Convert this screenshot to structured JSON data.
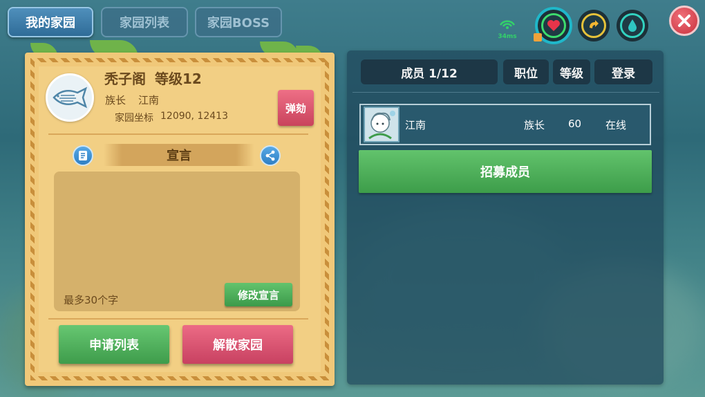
{
  "tabs": [
    {
      "label": "我的家园",
      "active": true
    },
    {
      "label": "家园列表",
      "active": false
    },
    {
      "label": "家园BOSS",
      "active": false
    }
  ],
  "status": {
    "ping": "34ms",
    "icons": [
      "heart-icon",
      "refresh-icon",
      "water-drop-icon"
    ]
  },
  "family": {
    "name": "秃子阁",
    "level_text": "等级12",
    "leader_label": "族长",
    "leader_name": "江南",
    "coord_label": "家园坐标",
    "coords": "12090, 12413",
    "impeach_label": "弹劾"
  },
  "declaration": {
    "title": "宣言",
    "char_limit": "最多30个字",
    "edit_label": "修改宣言"
  },
  "actions": {
    "apply_list": "申请列表",
    "disband": "解散家园"
  },
  "members": {
    "headers": {
      "count": "成员 1/12",
      "position": "职位",
      "level": "等级",
      "login": "登录"
    },
    "rows": [
      {
        "name": "江南",
        "position": "族长",
        "level": "60",
        "login": "在线"
      }
    ],
    "recruit_label": "招募成员"
  },
  "colors": {
    "tab_active": "#2f6c98",
    "card": "#f0c879",
    "button_green": "#3e9c4b",
    "button_red": "#c84161",
    "close": "#c8303c",
    "ping": "#33d16a"
  }
}
